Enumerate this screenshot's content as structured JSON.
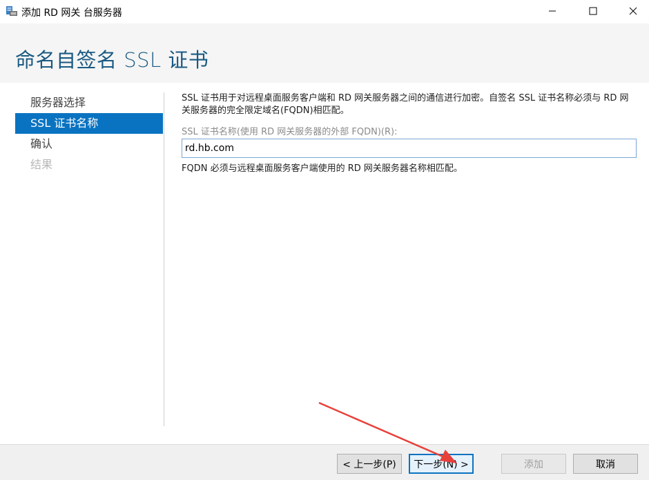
{
  "window": {
    "title": "添加 RD 网关 台服务器"
  },
  "header": {
    "page_title": "命名自签名 SSL 证书"
  },
  "nav": {
    "items": [
      {
        "label": "服务器选择",
        "state": "normal"
      },
      {
        "label": "SSL 证书名称",
        "state": "active"
      },
      {
        "label": "确认",
        "state": "normal"
      },
      {
        "label": "结果",
        "state": "disabled"
      }
    ]
  },
  "content": {
    "description": "SSL 证书用于对远程桌面服务客户端和 RD 网关服务器之间的通信进行加密。自签名 SSL 证书名称必须与 RD 网关服务器的完全限定域名(FQDN)相匹配。",
    "field_label": "SSL 证书名称(使用 RD 网关服务器的外部 FQDN)(R):",
    "field_value": "rd.hb.com",
    "hint": "FQDN 必须与远程桌面服务客户端使用的 RD 网关服务器名称相匹配。"
  },
  "footer": {
    "prev_label": "< 上一步(P)",
    "next_label": "下一步(N) >",
    "add_label": "添加",
    "cancel_label": "取消"
  },
  "colors": {
    "accent": "#0a73c1",
    "title": "#1a5a82",
    "annotation_arrow": "#e8403a"
  },
  "icons": {
    "app": "server-window-icon",
    "minimize": "minimize-icon",
    "maximize": "maximize-icon",
    "close": "close-icon"
  }
}
